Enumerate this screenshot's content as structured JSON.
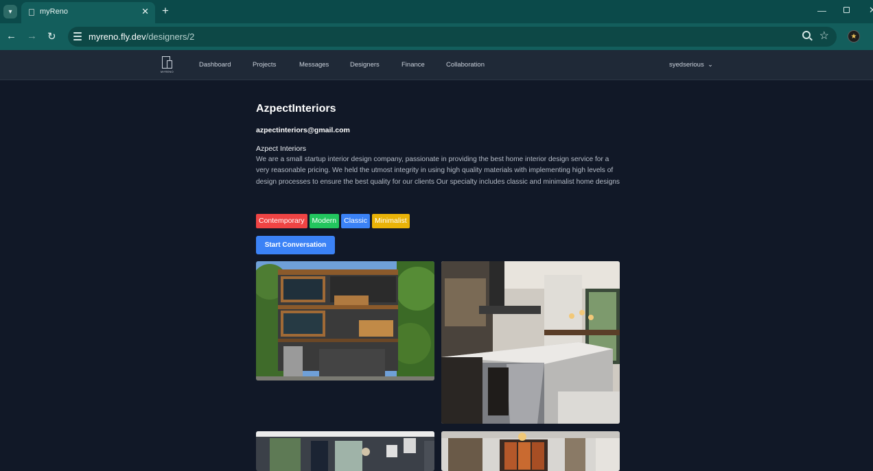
{
  "browser": {
    "tab_title": "myReno",
    "url_host": "myreno.fly.dev",
    "url_path": "/designers/2"
  },
  "nav": {
    "logo_text": "MYRENO",
    "links": [
      "Dashboard",
      "Projects",
      "Messages",
      "Designers",
      "Finance",
      "Collaboration"
    ],
    "user": "syedserious"
  },
  "designer": {
    "name": "AzpectInteriors",
    "email": "azpectinteriors@gmail.com",
    "company": "Azpect Interiors",
    "description": "We are a small startup interior design company, passionate in providing the best home interior design service for a very reasonable pricing. We held the utmost integrity in using high quality materials with implementing high levels of design processes to ensure the best quality for our clients Our specialty includes classic and minimalist home designs",
    "tags": [
      {
        "label": "Contemporary",
        "color": "#ef4444"
      },
      {
        "label": "Modern",
        "color": "#22c55e"
      },
      {
        "label": "Classic",
        "color": "#3b82f6"
      },
      {
        "label": "Minimalist",
        "color": "#eab308"
      }
    ],
    "start_button": "Start Conversation"
  },
  "colors": {
    "page_bg": "#111827",
    "nav_bg": "#1f2937",
    "browser_chrome": "#135e5c",
    "accent": "#3b82f6"
  }
}
